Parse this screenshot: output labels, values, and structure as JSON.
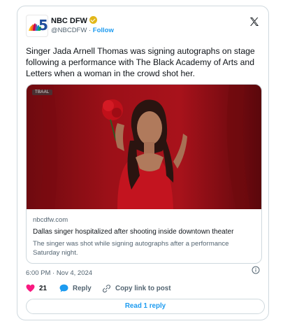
{
  "author": {
    "name": "NBC DFW",
    "handle": "@NBCDFW",
    "separator": "·",
    "follow_label": "Follow"
  },
  "tweet": {
    "text": "Singer Jada Arnell Thomas was signing autographs on stage following a performance with The Black Academy of Arts and Letters when a woman in the crowd shot her.",
    "timestamp": "6:00 PM · Nov 4, 2024"
  },
  "media": {
    "tag": "TBAAL",
    "domain": "nbcdfw.com",
    "title": "Dallas singer hospitalized after shooting inside downtown theater",
    "description": "The singer was shot while signing autographs after a performance Saturday night."
  },
  "actions": {
    "like_count": "21",
    "reply_label": "Reply",
    "copy_label": "Copy link to post",
    "read_replies_label": "Read 1 reply"
  },
  "icons": {
    "logo": "x-logo-icon",
    "verified": "verified-badge-icon",
    "info": "info-icon",
    "like": "heart-icon",
    "reply": "reply-bubble-icon",
    "copy": "link-icon"
  },
  "colors": {
    "accent": "#1d9bf0",
    "heart": "#f91880",
    "verified_gold": "#e2b719",
    "photo_red": "#b0121e"
  }
}
